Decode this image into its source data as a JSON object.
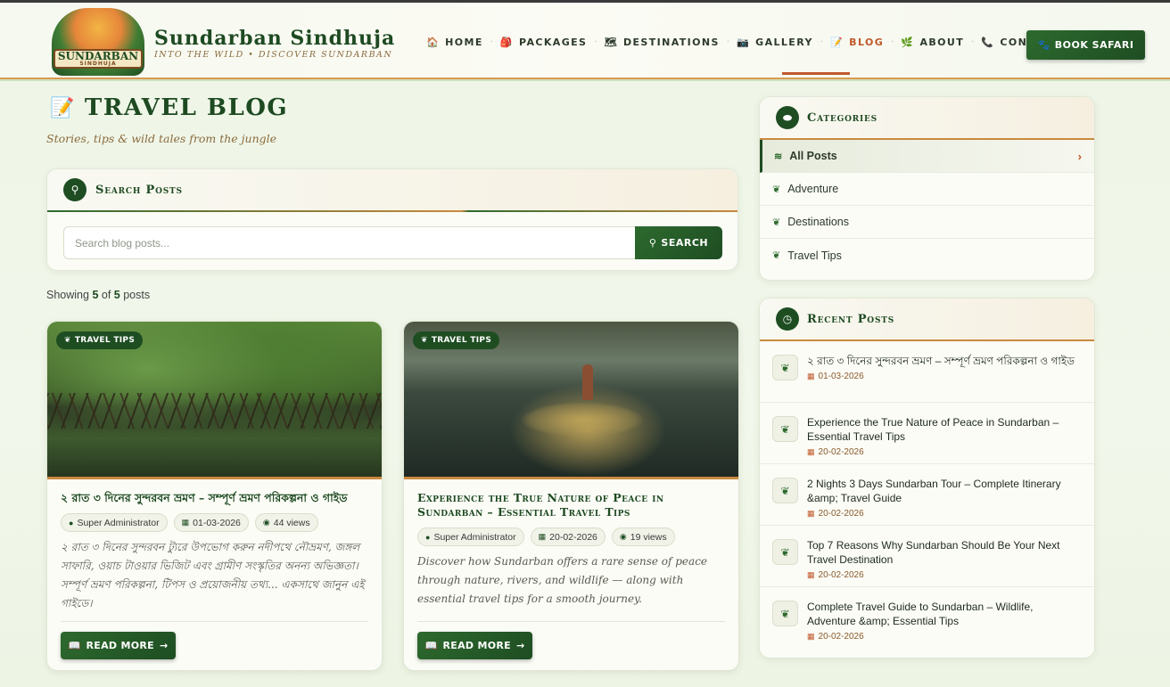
{
  "brand": {
    "logo_text": "SUNDARBAN",
    "logo_sub": "SINDHUJA",
    "title": "Sundarban Sindhuja",
    "tagline": "INTO THE WILD  •  DISCOVER SUNDARBAN"
  },
  "nav": {
    "items": [
      {
        "label": "HOME",
        "icon": "🏠"
      },
      {
        "label": "PACKAGES",
        "icon": "🎒"
      },
      {
        "label": "DESTINATIONS",
        "icon": "🗺"
      },
      {
        "label": "GALLERY",
        "icon": "📷"
      },
      {
        "label": "BLOG",
        "icon": "📝"
      },
      {
        "label": "ABOUT",
        "icon": "🌿"
      },
      {
        "label": "CONTACT",
        "icon": "📞"
      }
    ],
    "active": "BLOG",
    "book_label": "BOOK SAFARI"
  },
  "page": {
    "title": "TRAVEL BLOG",
    "subtitle": "Stories, tips & wild tales from the jungle"
  },
  "search": {
    "title": "Search Posts",
    "placeholder": "Search blog posts...",
    "value": "",
    "button": "SEARCH"
  },
  "showing": {
    "prefix": "Showing",
    "shown": "5",
    "of": "of",
    "total": "5",
    "suffix": "posts"
  },
  "posts": [
    {
      "tag": "TRAVEL TIPS",
      "title": "২ রাত ৩ দিনের সুন্দরবন ভ্রমণ – সম্পূর্ণ ভ্রমণ পরিকল্পনা ও গাইড",
      "author": "Super Administrator",
      "date": "01-03-2026",
      "views": "44 views",
      "excerpt": "২ রাত ৩ দিনের সুন্দরবন ট্যুরে উপভোগ করুন নদীপথে নৌভ্রমণ, জঙ্গল সাফারি, ওয়াচ টাওয়ার ভিজিট এবং গ্রামীণ সংস্কৃতির অনন্য অভিজ্ঞতা। সম্পূর্ণ ভ্রমণ পরিকল্পনা, টিপস ও প্রয়োজনীয় তথ্য... একসাথে জানুন এই গাইডে।",
      "read_more": "READ MORE"
    },
    {
      "tag": "TRAVEL TIPS",
      "title": "Experience the True Nature of Peace in Sundarban – Essential Travel Tips",
      "author": "Super Administrator",
      "date": "20-02-2026",
      "views": "19 views",
      "excerpt": "Discover how Sundarban offers a rare sense of peace through nature, rivers, and wildlife — along with essential travel tips for a smooth journey.",
      "read_more": "READ MORE"
    }
  ],
  "categories": {
    "title": "Categories",
    "items": [
      "All Posts",
      "Adventure",
      "Destinations",
      "Travel Tips"
    ],
    "active": "All Posts"
  },
  "recent": {
    "title": "Recent Posts",
    "items": [
      {
        "title": "২ রাত ৩ দিনের সুন্দরবন ভ্রমণ – সম্পূর্ণ ভ্রমণ পরিকল্পনা ও গাইড",
        "date": "01-03-2026"
      },
      {
        "title": "Experience the True Nature of Peace in Sundarban – Essential Travel Tips",
        "date": "20-02-2026"
      },
      {
        "title": "2 Nights 3 Days Sundarban Tour – Complete Itinerary &amp; Travel Guide",
        "date": "20-02-2026"
      },
      {
        "title": "Top 7 Reasons Why Sundarban Should Be Your Next Travel Destination",
        "date": "20-02-2026"
      },
      {
        "title": "Complete Travel Guide to Sundarban – Wildlife, Adventure &amp; Essential Tips",
        "date": "20-02-2026"
      }
    ]
  },
  "colors": {
    "primary_green": "#1e4d22",
    "accent_orange": "#c0582a",
    "gold": "#c98a3e",
    "background": "#eef5e6"
  }
}
